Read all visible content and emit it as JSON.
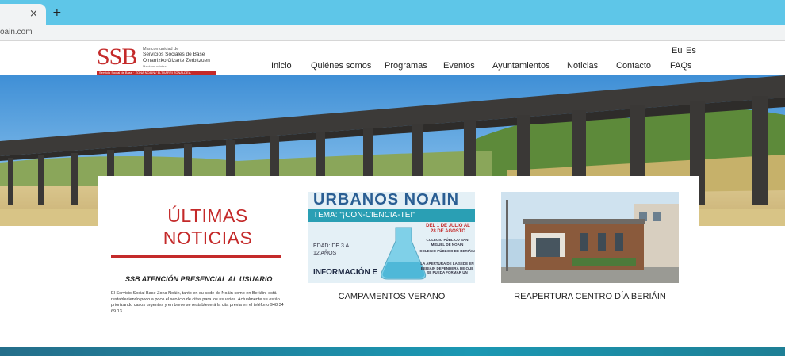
{
  "browser": {
    "tab_close": "×",
    "new_tab": "+",
    "url": "oain.com"
  },
  "logo": {
    "mark": "SSB",
    "line1": "Mancomunidad de",
    "line2": "Servicios Sociales de Base",
    "line3": "Oinarrizko Gizarte Zerbitzuen",
    "line4": "Mankomunitatea",
    "band": "Servicio Social de Base · ZONA NOÁIN / ELTXARRI ZONALDEA"
  },
  "nav": {
    "items": [
      {
        "label": "Inicio",
        "active": true
      },
      {
        "label": "Quiénes somos"
      },
      {
        "label": "Programas"
      },
      {
        "label": "Eventos"
      },
      {
        "label": "Ayuntamientos"
      },
      {
        "label": "Noticias"
      },
      {
        "label": "Contacto"
      },
      {
        "label": "FAQs"
      }
    ],
    "lang_eu": "Eu",
    "lang_es": "Es"
  },
  "news": {
    "heading_line1": "ÚLTIMAS",
    "heading_line2": "NOTICIAS",
    "title": "SSB ATENCIÓN PRESENCIAL AL USUARIO",
    "body": "El Servicio Social Base Zona Noáin, tanto en su sede de Noáin como en Beriáin, está restableciendo poco a poco el servicio de citas para los usuarios. Actualmente se están priorizando casos urgentes y en breve se restablecerá la cita previa en el teléfono 948 34 69 13."
  },
  "cards": [
    {
      "caption": "CAMPAMENTOS VERANO",
      "poster": {
        "headline": "URBANOS NOAIN",
        "tema": "TEMA: \"¡CON-CIENCIA-TE!\"",
        "edad": "EDAD: DE 3 A 12 AÑOS",
        "info": "INFORMACIÓN E",
        "dates": "DEL 1 DE JULIO AL 28 DE AGOSTO",
        "place1": "COLEGIO PÚBLICO SAN MIGUEL DE NOÁIN",
        "place2": "COLEGIO PÚBLICO DE BERIÁIN",
        "note": "LA APERTURA DE LA SEDE EN BERIÁIN DEPENDERÁ DE QUE SE PUEDA FORMAR UN"
      }
    },
    {
      "caption": "REAPERTURA CENTRO DÍA BERIÁIN"
    }
  ],
  "colors": {
    "brand_red": "#c42a2a",
    "chrome_blue": "#5ec6e8",
    "footer_teal": "#1b98b3"
  }
}
